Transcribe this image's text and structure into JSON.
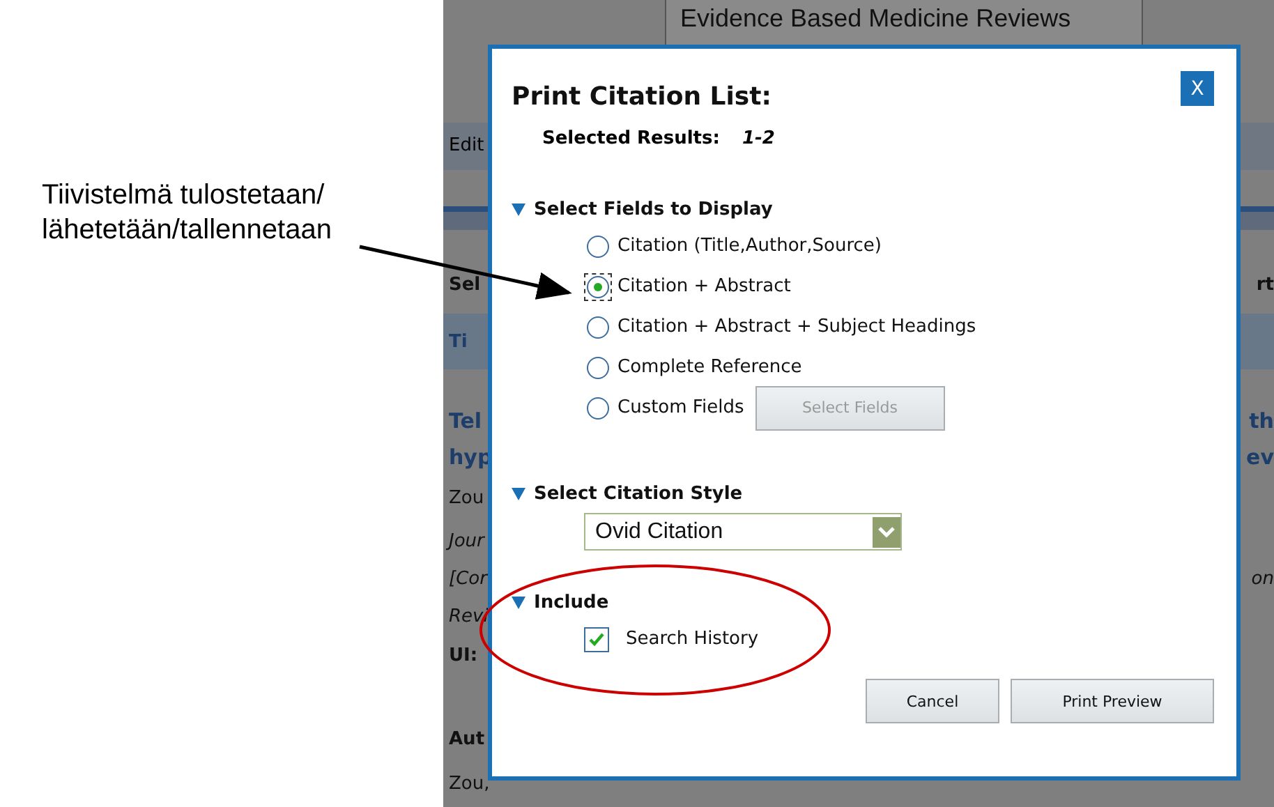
{
  "annotation": {
    "lines": [
      "Tiivistelmä tulostetaan/",
      "lähetetään/tallennetaan"
    ]
  },
  "background": {
    "banner": "Evidence Based Medicine Reviews",
    "rows": [
      {
        "kind": "band",
        "left": "Edit"
      },
      {
        "kind": "stripe"
      },
      {
        "kind": "bold",
        "left": "Sel",
        "right": "rt"
      },
      {
        "kind": "header",
        "left": "Ti"
      },
      {
        "kind": "link",
        "left": "Tel",
        "right": "th"
      },
      {
        "kind": "link",
        "left": "hyp",
        "right": "ev"
      },
      {
        "kind": "plain",
        "left": "Zou"
      },
      {
        "kind": "italic",
        "left": "Jour"
      },
      {
        "kind": "italic",
        "left": "[Cor",
        "right": "on"
      },
      {
        "kind": "italic",
        "left": "Revi"
      },
      {
        "kind": "bold",
        "left": "UI:"
      },
      {
        "kind": "gap"
      },
      {
        "kind": "bold",
        "left": "Aut"
      },
      {
        "kind": "plain",
        "left": "Zou,"
      }
    ]
  },
  "dialog": {
    "title": "Print Citation List:",
    "close": "X",
    "selected_results": {
      "label": "Selected Results:",
      "value": "1-2"
    },
    "fields_section": {
      "title": "Select Fields to Display",
      "expanded": true,
      "options": [
        {
          "label": "Citation (Title,Author,Source)",
          "selected": false
        },
        {
          "label": "Citation + Abstract",
          "selected": true
        },
        {
          "label": "Citation + Abstract + Subject Headings",
          "selected": false
        },
        {
          "label": "Complete Reference",
          "selected": false
        },
        {
          "label": "Custom Fields",
          "selected": false,
          "button": {
            "label": "Select Fields",
            "disabled": true
          }
        }
      ]
    },
    "style_section": {
      "title": "Select Citation Style",
      "expanded": true,
      "value": "Ovid Citation"
    },
    "include_section": {
      "title": "Include",
      "expanded": true,
      "options": [
        {
          "label": "Search History",
          "checked": true
        }
      ]
    },
    "buttons": [
      "Cancel",
      "Print Preview"
    ]
  }
}
